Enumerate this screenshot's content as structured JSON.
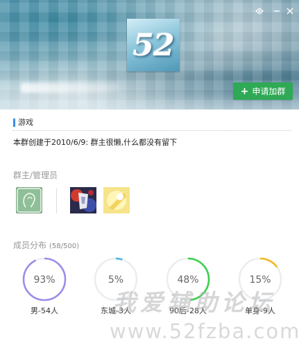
{
  "window": {
    "controls": [
      "pin-icon",
      "minimize-icon",
      "close-icon"
    ]
  },
  "group": {
    "logo_text": "52",
    "apply_button": {
      "label": "申请加群",
      "icon": "plus-icon",
      "color": "#2fa955"
    },
    "tag": "游戏",
    "intro": "本群创建于2010/6/9: 群主很懒,什么都没有留下"
  },
  "admins": {
    "title": "群主/管理员",
    "avatars": [
      "owner-avatar",
      "admin-avatar-1",
      "admin-avatar-2"
    ]
  },
  "members": {
    "title": "成员分布",
    "count": "(58/500)",
    "stats": [
      {
        "percent_label": "93%",
        "fraction": 0.93,
        "caption": "男-54人",
        "color": "#9b8ee8"
      },
      {
        "percent_label": "5%",
        "fraction": 0.05,
        "caption": "东城-3人",
        "color": "#4db3e6"
      },
      {
        "percent_label": "48%",
        "fraction": 0.48,
        "caption": "90后-28人",
        "color": "#3ccf4e"
      },
      {
        "percent_label": "15%",
        "fraction": 0.15,
        "caption": "单身-9人",
        "color": "#f2b920"
      }
    ]
  },
  "watermark": {
    "cn": "我爱辅助论坛",
    "url": "www.52fzba.com"
  }
}
